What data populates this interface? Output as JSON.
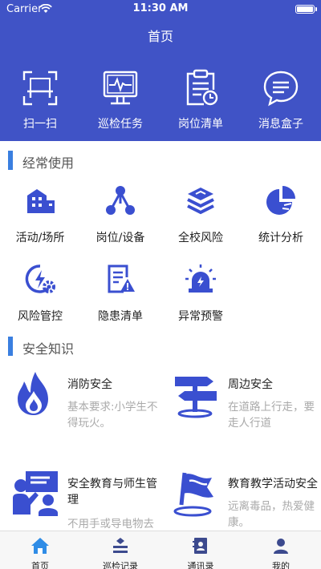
{
  "status_bar": {
    "carrier": "Carrier",
    "time": "11:30 AM"
  },
  "nav": {
    "title": "首页"
  },
  "quick_actions": [
    {
      "label": "扫一扫",
      "icon": "scan-icon"
    },
    {
      "label": "巡检任务",
      "icon": "monitor-icon"
    },
    {
      "label": "岗位清单",
      "icon": "clipboard-icon"
    },
    {
      "label": "消息盒子",
      "icon": "message-icon"
    }
  ],
  "frequent": {
    "title": "经常使用",
    "items": [
      {
        "label": "活动/场所",
        "icon": "building-icon"
      },
      {
        "label": "岗位/设备",
        "icon": "network-icon"
      },
      {
        "label": "全校风险",
        "icon": "layers-icon"
      },
      {
        "label": "统计分析",
        "icon": "pie-chart-icon"
      },
      {
        "label": "风险管控",
        "icon": "risk-control-icon"
      },
      {
        "label": "隐患清单",
        "icon": "hazard-list-icon"
      },
      {
        "label": "异常预警",
        "icon": "alarm-icon"
      }
    ]
  },
  "knowledge": {
    "title": "安全知识",
    "cards": [
      {
        "title": "消防安全",
        "desc": "基本要求:小学生不得玩火。",
        "icon": "fire-icon"
      },
      {
        "title": "周边安全",
        "desc": "在道路上行走，要走人行道",
        "icon": "signpost-icon"
      },
      {
        "title": "安全教育与师生管理",
        "desc": "不用手或导电物去",
        "icon": "classroom-icon"
      },
      {
        "title": "教育教学活动安全",
        "desc": "远离毒品，热爱健康。",
        "icon": "flag-icon"
      }
    ]
  },
  "tabbar": [
    {
      "label": "首页",
      "icon": "home-icon",
      "active": true
    },
    {
      "label": "巡检记录",
      "icon": "inspection-record-icon"
    },
    {
      "label": "通讯录",
      "icon": "contacts-icon"
    },
    {
      "label": "我的",
      "icon": "user-icon"
    }
  ],
  "colors": {
    "primary": "#4053c6",
    "icon_blue": "#3a4fd0",
    "accent_bar": "#3a7fe0",
    "active_tab": "#2f8ce6"
  }
}
